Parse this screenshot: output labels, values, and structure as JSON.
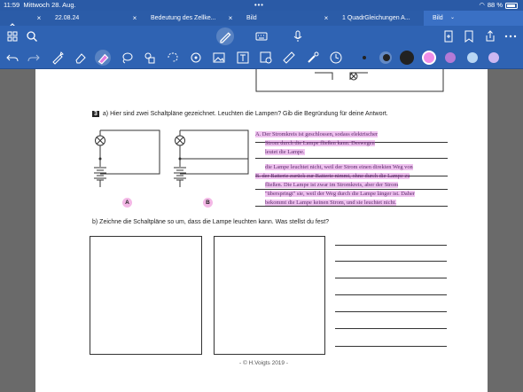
{
  "status": {
    "time": "11:59",
    "date": "Mittwoch 28. Aug.",
    "battery": "88 %"
  },
  "tabs": [
    {
      "label": "22.08.24"
    },
    {
      "label": "Bedeutung des Zellke..."
    },
    {
      "label": "Bild"
    },
    {
      "label": "1 QuadrGleichungen A..."
    },
    {
      "label": "Bild"
    }
  ],
  "colors": {
    "accent": "#2f63b3",
    "highlight": "#e07ae0",
    "handwriting": "#5a2a6a"
  },
  "pens": [
    {
      "name": "dot-small-black",
      "color": "#222222"
    },
    {
      "name": "dot-medium-black",
      "color": "#222222"
    },
    {
      "name": "dot-large-black",
      "color": "#222222"
    },
    {
      "name": "dot-pink",
      "color": "#ef8ee8"
    },
    {
      "name": "dot-purple",
      "color": "#b47ad6"
    },
    {
      "name": "dot-lightblue",
      "color": "#b8d6f4"
    },
    {
      "name": "dot-lavender",
      "color": "#cdb7f2"
    }
  ],
  "worksheet": {
    "task_number": "3",
    "part_a": "a)  Hier sind zwei Schaltpläne gezeichnet. Leuchten die Lampen? Gib die Begründung für deine Antwort.",
    "label_a": "A",
    "label_b": "B",
    "answer_a_1": "A.  Der Stromkreis ist geschlossen, sodass elektrischer",
    "answer_a_2": "Strom durch die Lampe fließen kann. Deswegen",
    "answer_a_3": "leutet die Lampe.",
    "answer_b_1": "die Lampe leuchtet nicht, weil der Strom einen direkten Weg von",
    "answer_b_2": "B.  der Batterie zurück zur Batterie nimmt, ohne durch die Lampe zu",
    "answer_b_3": "fließen. Die Lampe ist zwar im Stromkreis, aber der Strom",
    "answer_b_4": "\"überspringt\" sie, weil der Weg durch die Lampe länger ist. Daher",
    "answer_b_5": "bekommt die Lampe keinen Strom, und sie leuchtet nicht.",
    "part_b": "b)  Zeichne die Schaltpläne so um, dass die Lampe leuchten kann. Was stellst du fest?",
    "footer": "-  © H.Voigts 2019  -"
  }
}
